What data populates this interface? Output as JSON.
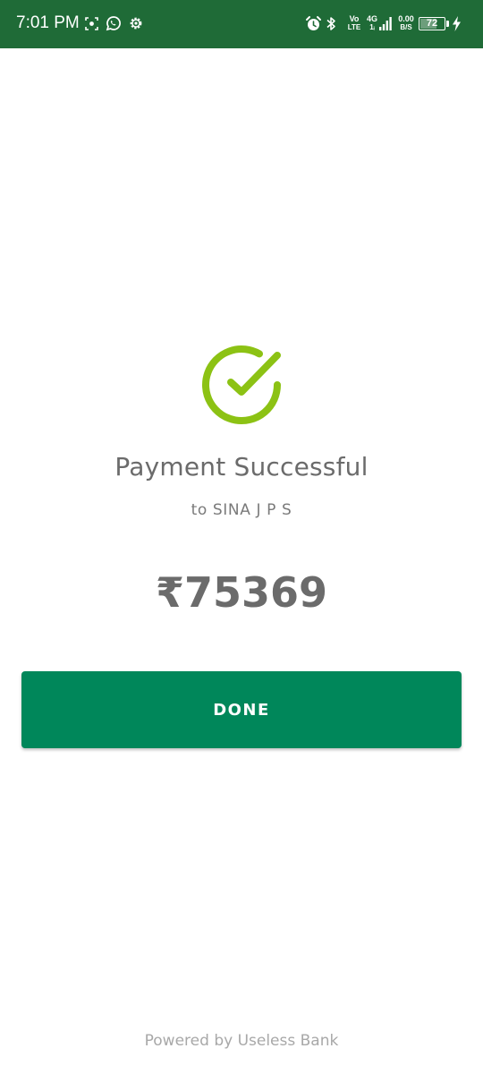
{
  "status_bar": {
    "time": "7:01 PM",
    "volte_top": "Vo",
    "volte_bottom": "LTE",
    "network_top": "4G",
    "network_bottom": "1ᵢ",
    "speed_value": "0.00",
    "speed_unit": "B/S",
    "battery_level": "72",
    "battery_fraction": 0.72,
    "icons": [
      "screenshot-icon",
      "whatsapp-icon",
      "settings-icon",
      "alarm-icon",
      "bluetooth-icon",
      "signal-icon",
      "battery-icon",
      "charging-icon"
    ]
  },
  "payment": {
    "status_icon": "check-circle-icon",
    "title": "Payment Successful",
    "recipient": "to SINA J P S",
    "amount": "₹75369"
  },
  "actions": {
    "done_label": "DONE"
  },
  "footer": {
    "text": "Powered by Useless Bank"
  },
  "colors": {
    "status_bar": "#1f6b37",
    "accent_check": "#8cc214",
    "button": "#00875a",
    "text_primary": "#6b6b6b",
    "text_footer": "#a8a8a8"
  }
}
